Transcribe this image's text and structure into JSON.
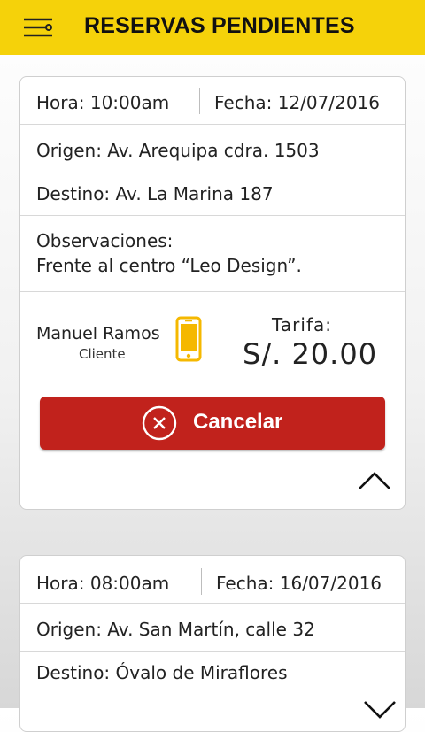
{
  "header": {
    "title": "RESERVAS PENDIENTES",
    "menu_icon": "menu-sliders-icon",
    "accent": "#f5d20a"
  },
  "reservations": [
    {
      "hora": "Hora: 10:00am",
      "fecha": "Fecha: 12/07/2016",
      "origen": "Origen: Av. Arequipa cdra. 1503",
      "destino": "Destino: Av. La Marina 187",
      "observaciones_label": "Observaciones:",
      "observaciones": "Frente al centro “Leo Design”.",
      "client_name": "Manuel Ramos",
      "client_role": "Cliente",
      "phone_icon": "phone-icon",
      "tarifa_label": "Tarifa:",
      "tarifa_value": "S/. 20.00",
      "cancel_label": "Cancelar",
      "cancel_color": "#c1221c",
      "expanded": true
    },
    {
      "hora": "Hora: 08:00am",
      "fecha": "Fecha: 16/07/2016",
      "origen": "Origen: Av. San Martín, calle 32",
      "destino": "Destino: Óvalo de Miraflores",
      "expanded": false
    }
  ]
}
